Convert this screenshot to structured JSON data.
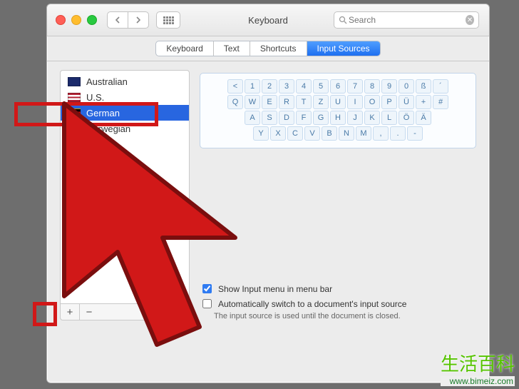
{
  "titlebar": {
    "title": "Keyboard",
    "search_placeholder": "Search"
  },
  "tabs": [
    {
      "label": "Keyboard",
      "active": false
    },
    {
      "label": "Text",
      "active": false
    },
    {
      "label": "Shortcuts",
      "active": false
    },
    {
      "label": "Input Sources",
      "active": true
    }
  ],
  "sources": [
    {
      "name": "Australian",
      "flag": "au",
      "selected": false
    },
    {
      "name": "U.S.",
      "flag": "us",
      "selected": false
    },
    {
      "name": "German",
      "flag": "de",
      "selected": true
    },
    {
      "name": "Norwegian",
      "flag": "no",
      "selected": false
    }
  ],
  "add_remove": {
    "plus": "+",
    "minus": "−"
  },
  "keyboard_rows": [
    [
      "<",
      "1",
      "2",
      "3",
      "4",
      "5",
      "6",
      "7",
      "8",
      "9",
      "0",
      "ß",
      "´"
    ],
    [
      "Q",
      "W",
      "E",
      "R",
      "T",
      "Z",
      "U",
      "I",
      "O",
      "P",
      "Ü",
      "+",
      "#"
    ],
    [
      "A",
      "S",
      "D",
      "F",
      "G",
      "H",
      "J",
      "K",
      "L",
      "Ö",
      "Ä"
    ],
    [
      "Y",
      "X",
      "C",
      "V",
      "B",
      "N",
      "M",
      ",",
      ".",
      "-"
    ]
  ],
  "options": {
    "show_in_menubar": {
      "label": "Show Input menu in menu bar",
      "checked": true
    },
    "auto_switch": {
      "label": "Automatically switch to a document's input source",
      "checked": false
    },
    "auto_switch_note": "The input source is used until the document is closed."
  },
  "watermark": {
    "title": "生活百科",
    "url": "www.bimeiz.com"
  }
}
